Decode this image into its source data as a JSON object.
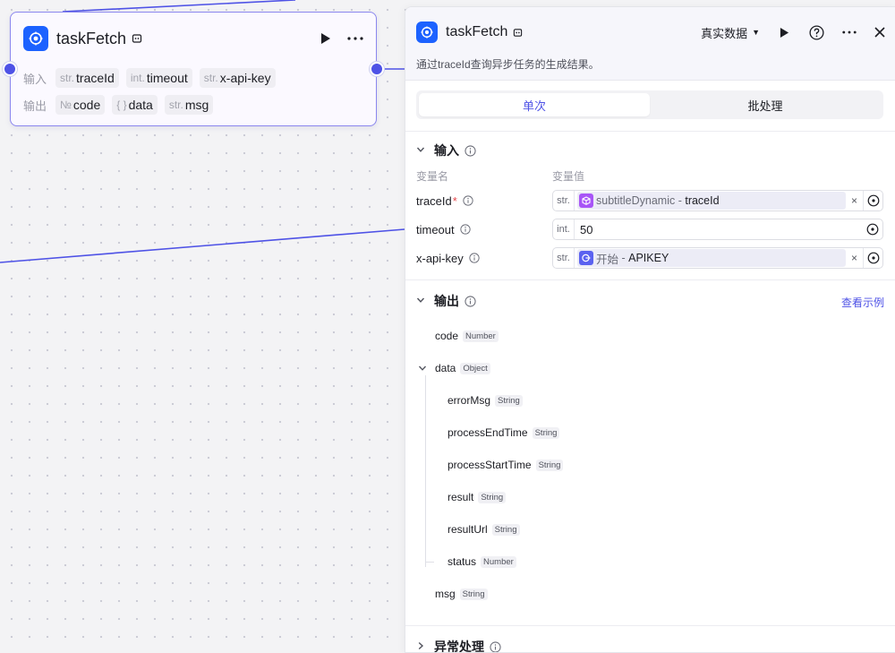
{
  "node": {
    "title": "taskFetch",
    "inputs_label": "输入",
    "outputs_label": "输出",
    "inputs": [
      {
        "type": "str.",
        "name": "traceId"
      },
      {
        "type": "int.",
        "name": "timeout"
      },
      {
        "type": "str.",
        "name": "x-api-key"
      }
    ],
    "outputs": [
      {
        "type": "№",
        "name": "code"
      },
      {
        "type": "{ }",
        "name": "data"
      },
      {
        "type": "str.",
        "name": "msg"
      }
    ]
  },
  "panel": {
    "title": "taskFetch",
    "data_source": "真实数据",
    "description": "通过traceId查询异步任务的生成结果。",
    "tabs": [
      "单次",
      "批处理"
    ],
    "active_tab": 0,
    "input_section": {
      "title": "输入",
      "col_name": "变量名",
      "col_value": "变量值",
      "vars": [
        {
          "name": "traceId",
          "required": "*",
          "type": "str.",
          "ref_node": "subtitleDynamic",
          "ref_sep": " - ",
          "ref_field": "traceId"
        },
        {
          "name": "timeout",
          "type": "int.",
          "value": "50"
        },
        {
          "name": "x-api-key",
          "type": "str.",
          "ref_node": "开始",
          "ref_sep": " - ",
          "ref_field": "APIKEY"
        }
      ]
    },
    "output_section": {
      "title": "输出",
      "link": "查看示例",
      "fields": [
        {
          "name": "code",
          "type": "Number"
        },
        {
          "name": "data",
          "type": "Object"
        },
        {
          "name": "errorMsg",
          "type": "String"
        },
        {
          "name": "processEndTime",
          "type": "String"
        },
        {
          "name": "processStartTime",
          "type": "String"
        },
        {
          "name": "result",
          "type": "String"
        },
        {
          "name": "resultUrl",
          "type": "String"
        },
        {
          "name": "status",
          "type": "Number"
        },
        {
          "name": "msg",
          "type": "String"
        }
      ]
    },
    "error_section": {
      "title": "异常处理"
    }
  },
  "colors": {
    "accent": "#4e52e6",
    "brand_blue": "#1c62ff",
    "ref_purple": "#a855f7",
    "ref_blue": "#5b62f0"
  },
  "icons": [
    "node-logo-icon",
    "debug-icon",
    "run-icon",
    "more-icon",
    "help-icon",
    "close-icon",
    "info-icon",
    "chevron-down-icon",
    "chevron-right-icon",
    "target-icon",
    "clear-icon",
    "cube-icon",
    "start-icon"
  ]
}
